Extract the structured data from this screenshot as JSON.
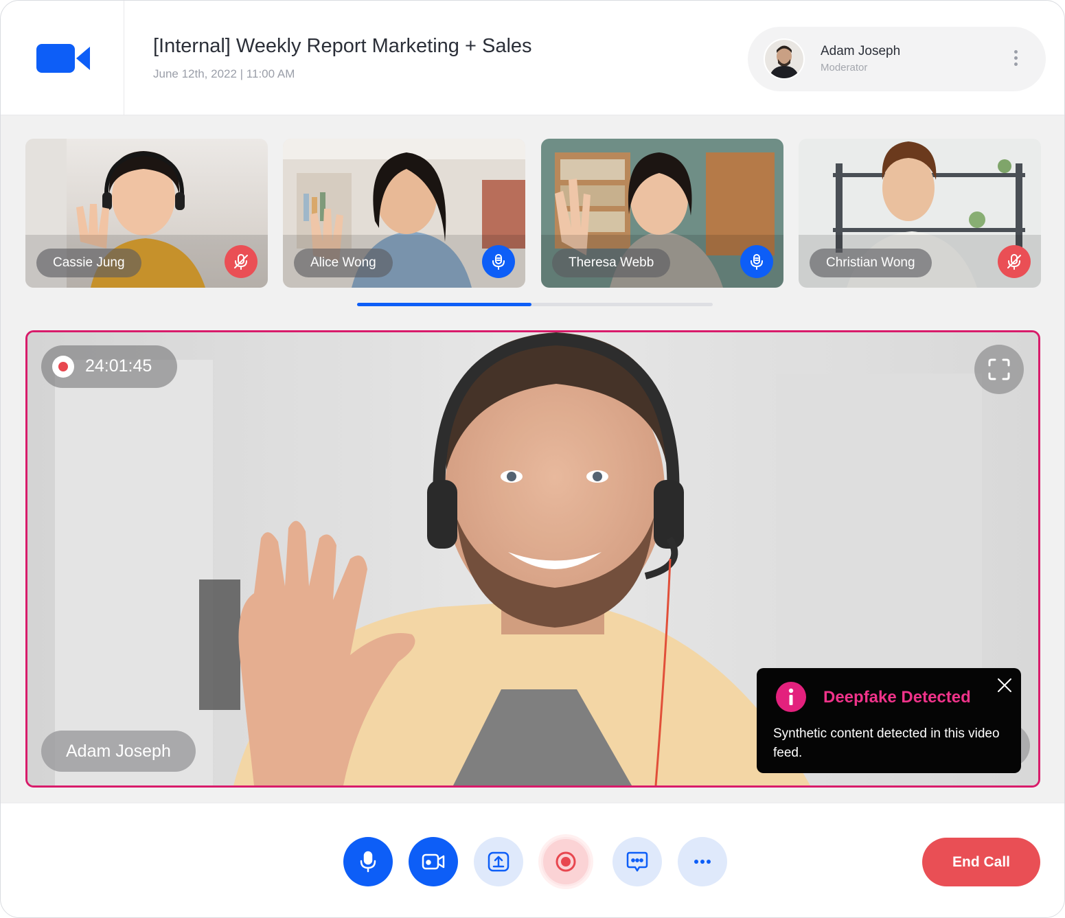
{
  "app": {
    "logo_icon": "video-camera-icon",
    "accent_color": "#0d5ef7",
    "danger_color": "#e94f55",
    "alert_color": "#e3217d"
  },
  "header": {
    "title": "[Internal] Weekly Report Marketing + Sales",
    "date": "June 12th, 2022 | 11:00 AM",
    "user": {
      "name": "Adam Joseph",
      "role": "Moderator",
      "menu_icon": "more-vertical-icon"
    }
  },
  "participants": [
    {
      "name": "Cassie Jung",
      "mic": "muted",
      "mic_icon": "mic-off-icon"
    },
    {
      "name": "Alice Wong",
      "mic": "on",
      "mic_icon": "mic-icon"
    },
    {
      "name": "Theresa Webb",
      "mic": "on",
      "mic_icon": "mic-icon"
    },
    {
      "name": "Christian Wong",
      "mic": "muted",
      "mic_icon": "mic-off-icon"
    }
  ],
  "pager": {
    "progress": 0.49
  },
  "main_video": {
    "speaker": "Adam Joseph",
    "recording_time": "24:01:45",
    "fullscreen_icon": "fullscreen-icon"
  },
  "alert": {
    "title": "Deepfake Detected",
    "body": "Synthetic content detected in this video feed.",
    "icon": "info-icon",
    "close_icon": "close-icon"
  },
  "controls": [
    {
      "id": "mic",
      "icon": "mic-icon"
    },
    {
      "id": "camera",
      "icon": "video-camera-icon"
    },
    {
      "id": "share",
      "icon": "share-screen-icon"
    },
    {
      "id": "record",
      "icon": "record-icon"
    },
    {
      "id": "chat",
      "icon": "chat-icon"
    },
    {
      "id": "more",
      "icon": "more-horizontal-icon"
    }
  ],
  "end_call_label": "End Call"
}
